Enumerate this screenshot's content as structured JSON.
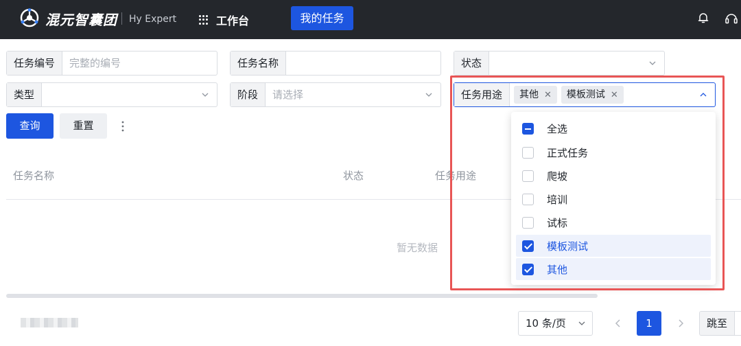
{
  "header": {
    "brand": "混元智囊团",
    "brand_sub": "Hy Expert",
    "workbench": "工作台",
    "my_tasks": "我的任务"
  },
  "filters": {
    "task_id": {
      "label": "任务编号",
      "placeholder": "完整的编号"
    },
    "task_name": {
      "label": "任务名称",
      "value": ""
    },
    "status": {
      "label": "状态",
      "value": ""
    },
    "type": {
      "label": "类型",
      "value": ""
    },
    "stage": {
      "label": "阶段",
      "placeholder": "请选择"
    },
    "purpose": {
      "label": "任务用途",
      "tags": [
        "其他",
        "模板测试"
      ]
    }
  },
  "buttons": {
    "query": "查询",
    "reset": "重置"
  },
  "table": {
    "columns": [
      "任务名称",
      "状态",
      "任务用途"
    ],
    "empty_text": "暂无数据"
  },
  "dropdown": {
    "select_all": "全选",
    "options": [
      {
        "label": "正式任务",
        "checked": false
      },
      {
        "label": "爬坡",
        "checked": false
      },
      {
        "label": "培训",
        "checked": false
      },
      {
        "label": "试标",
        "checked": false
      },
      {
        "label": "模板测试",
        "checked": true
      },
      {
        "label": "其他",
        "checked": true
      }
    ]
  },
  "pagination": {
    "page_size": "10 条/页",
    "current_page": "1",
    "jump_label": "跳至"
  },
  "colors": {
    "primary": "#1d56e0",
    "topbar": "#24272c",
    "highlight": "#e85555"
  }
}
